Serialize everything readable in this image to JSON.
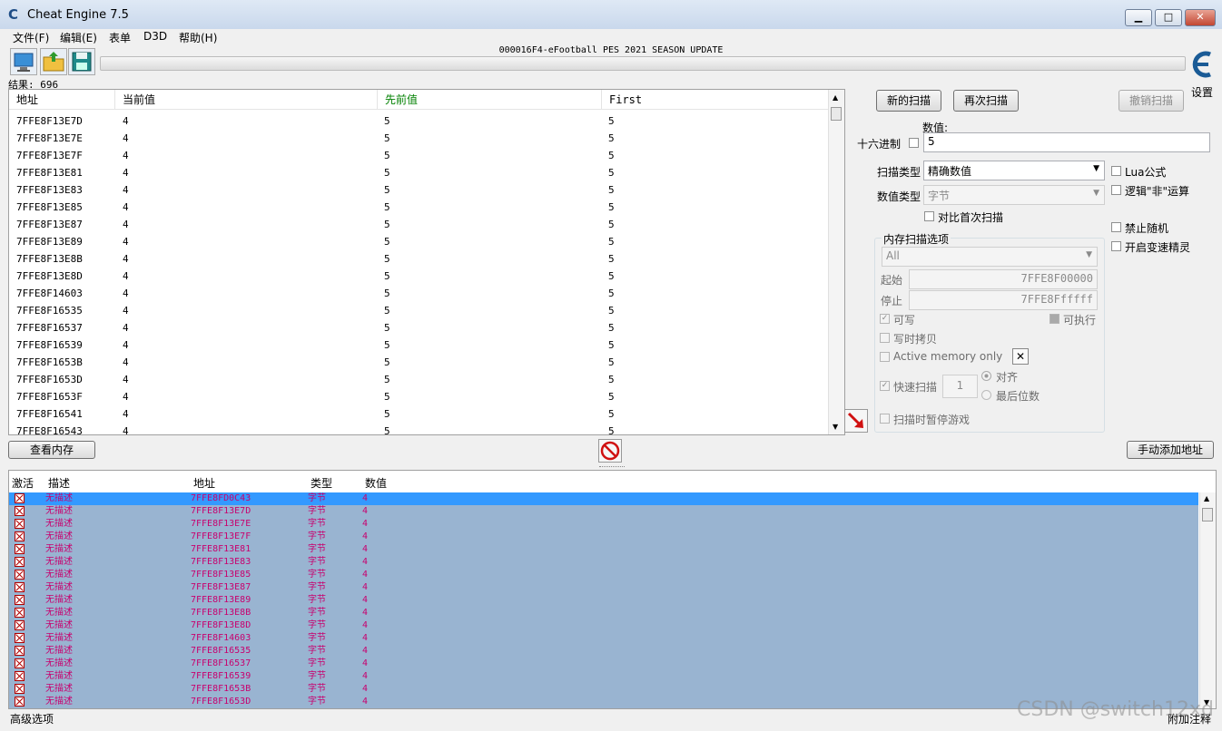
{
  "window": {
    "title": "Cheat Engine 7.5",
    "min": "▁",
    "max": "□",
    "close": "✕"
  },
  "menu": [
    "文件(F)",
    "编辑(E)",
    "表单",
    "D3D",
    "帮助(H)"
  ],
  "process": "000016F4-eFootball PES 2021 SEASON UPDATE",
  "results_label": "结果: 696",
  "settings_label": "设置",
  "results_table": {
    "headers": [
      "地址",
      "当前值",
      "先前值",
      "First"
    ],
    "rows": [
      [
        "7FFE8F13E7D",
        "4",
        "5",
        "5"
      ],
      [
        "7FFE8F13E7E",
        "4",
        "5",
        "5"
      ],
      [
        "7FFE8F13E7F",
        "4",
        "5",
        "5"
      ],
      [
        "7FFE8F13E81",
        "4",
        "5",
        "5"
      ],
      [
        "7FFE8F13E83",
        "4",
        "5",
        "5"
      ],
      [
        "7FFE8F13E85",
        "4",
        "5",
        "5"
      ],
      [
        "7FFE8F13E87",
        "4",
        "5",
        "5"
      ],
      [
        "7FFE8F13E89",
        "4",
        "5",
        "5"
      ],
      [
        "7FFE8F13E8B",
        "4",
        "5",
        "5"
      ],
      [
        "7FFE8F13E8D",
        "4",
        "5",
        "5"
      ],
      [
        "7FFE8F14603",
        "4",
        "5",
        "5"
      ],
      [
        "7FFE8F16535",
        "4",
        "5",
        "5"
      ],
      [
        "7FFE8F16537",
        "4",
        "5",
        "5"
      ],
      [
        "7FFE8F16539",
        "4",
        "5",
        "5"
      ],
      [
        "7FFE8F1653B",
        "4",
        "5",
        "5"
      ],
      [
        "7FFE8F1653D",
        "4",
        "5",
        "5"
      ],
      [
        "7FFE8F1653F",
        "4",
        "5",
        "5"
      ],
      [
        "7FFE8F16541",
        "4",
        "5",
        "5"
      ],
      [
        "7FFE8F16543",
        "4",
        "5",
        "5"
      ]
    ]
  },
  "scan_panel": {
    "new_scan": "新的扫描",
    "next_scan": "再次扫描",
    "undo_scan": "撤销扫描",
    "value_label": "数值:",
    "hex_label": "十六进制",
    "value": "5",
    "scan_type_label": "扫描类型",
    "scan_type": "精确数值",
    "value_type_label": "数值类型",
    "value_type": "字节",
    "compare_first": "对比首次扫描",
    "lua_formula": "Lua公式",
    "logical_not": "逻辑\"非\"运算",
    "no_random": "禁止随机",
    "speedhack": "开启变速精灵",
    "mem_group_title": "内存扫描选项",
    "mem_region": "All",
    "start_label": "起始",
    "start_value": "7FFE8F00000",
    "stop_label": "停止",
    "stop_value": "7FFE8Ffffff",
    "writable": "可写",
    "executable": "可执行",
    "copy_on_write": "写时拷贝",
    "active_memory_only": "Active memory only",
    "fast_scan": "快速扫描",
    "fast_scan_value": "1",
    "align": "对齐",
    "last_digits": "最后位数",
    "pause_game": "扫描时暂停游戏"
  },
  "memory_view_button": "查看内存",
  "manual_add_button": "手动添加地址",
  "address_table": {
    "headers": [
      "激活",
      "描述",
      "地址",
      "类型",
      "数值"
    ],
    "rows": [
      [
        "无描述",
        "7FFE8FD0C43",
        "字节",
        "4"
      ],
      [
        "无描述",
        "7FFE8F13E7D",
        "字节",
        "4"
      ],
      [
        "无描述",
        "7FFE8F13E7E",
        "字节",
        "4"
      ],
      [
        "无描述",
        "7FFE8F13E7F",
        "字节",
        "4"
      ],
      [
        "无描述",
        "7FFE8F13E81",
        "字节",
        "4"
      ],
      [
        "无描述",
        "7FFE8F13E83",
        "字节",
        "4"
      ],
      [
        "无描述",
        "7FFE8F13E85",
        "字节",
        "4"
      ],
      [
        "无描述",
        "7FFE8F13E87",
        "字节",
        "4"
      ],
      [
        "无描述",
        "7FFE8F13E89",
        "字节",
        "4"
      ],
      [
        "无描述",
        "7FFE8F13E8B",
        "字节",
        "4"
      ],
      [
        "无描述",
        "7FFE8F13E8D",
        "字节",
        "4"
      ],
      [
        "无描述",
        "7FFE8F14603",
        "字节",
        "4"
      ],
      [
        "无描述",
        "7FFE8F16535",
        "字节",
        "4"
      ],
      [
        "无描述",
        "7FFE8F16537",
        "字节",
        "4"
      ],
      [
        "无描述",
        "7FFE8F16539",
        "字节",
        "4"
      ],
      [
        "无描述",
        "7FFE8F1653B",
        "字节",
        "4"
      ],
      [
        "无描述",
        "7FFE8F1653D",
        "字节",
        "4"
      ]
    ]
  },
  "status": {
    "advanced": "高级选项",
    "comments": "附加注释"
  },
  "watermark": "CSDN @switch12xd"
}
